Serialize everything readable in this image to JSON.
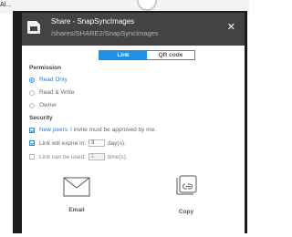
{
  "background": {
    "fragment_text": "AI..."
  },
  "dialog": {
    "title": "Share - SnapSyncImages",
    "path": "/shares/SHARE2/SnapSyncImages",
    "close_symbol": "✕",
    "tabs": [
      {
        "label": "Link",
        "active": true
      },
      {
        "label": "QR code",
        "active": false
      }
    ],
    "permission": {
      "title": "Permission",
      "options": [
        {
          "label": "Read Only",
          "checked": true
        },
        {
          "label": "Read & Write",
          "checked": false
        },
        {
          "label": "Owner",
          "checked": false
        }
      ]
    },
    "security": {
      "title": "Security",
      "new_peers": {
        "link": "New peers",
        "text": "I invite must be approved by me.",
        "checked": true
      },
      "expire": {
        "prefix": "Link will expire in:",
        "value": "3",
        "suffix": "day(s).",
        "checked": true
      },
      "used": {
        "prefix": "Link can be used:",
        "value": "1",
        "suffix": "time(s).",
        "checked": false
      }
    },
    "actions": {
      "email_label": "Email",
      "copy_label": "Copy"
    },
    "colors": {
      "accent": "#1e90e8",
      "header_bg": "#434343",
      "frame": "#1d1d1d"
    },
    "icons": [
      "folder-icon",
      "close-icon",
      "mail-icon",
      "copy-link-icon"
    ]
  }
}
